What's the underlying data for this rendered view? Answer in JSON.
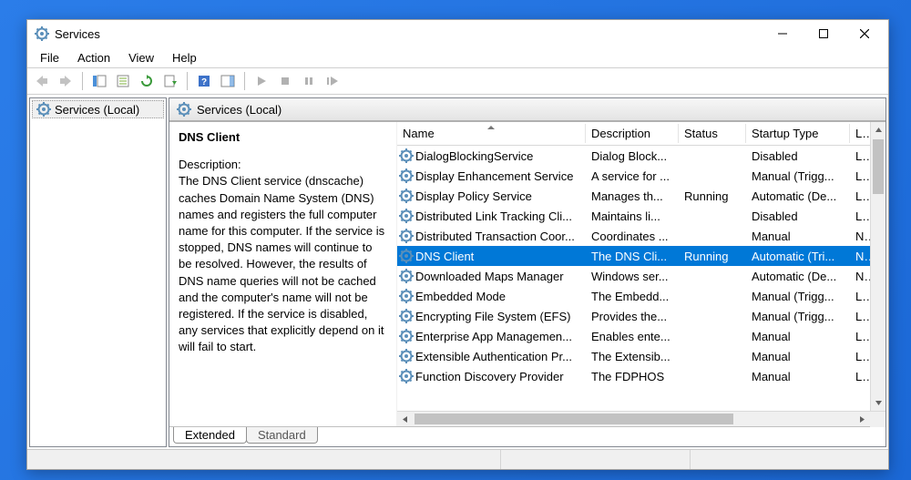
{
  "title": "Services",
  "menu": {
    "file": "File",
    "action": "Action",
    "view": "View",
    "help": "Help"
  },
  "tree": {
    "root": "Services (Local)"
  },
  "header": {
    "label": "Services (Local)"
  },
  "details": {
    "name": "DNS Client",
    "desc_label": "Description:",
    "desc_text": "The DNS Client service (dnscache) caches Domain Name System (DNS) names and registers the full computer name for this computer. If the service is stopped, DNS names will continue to be resolved. However, the results of DNS name queries will not be cached and the computer's name will not be registered. If the service is disabled, any services that explicitly depend on it will fail to start."
  },
  "columns": {
    "name": "Name",
    "desc": "Description",
    "status": "Status",
    "start": "Startup Type",
    "logon": "Log"
  },
  "rows": [
    {
      "name": "DialogBlockingService",
      "desc": "Dialog Block...",
      "status": "",
      "start": "Disabled",
      "logon": "Loc",
      "sel": false
    },
    {
      "name": "Display Enhancement Service",
      "desc": "A service for ...",
      "status": "",
      "start": "Manual (Trigg...",
      "logon": "Loc",
      "sel": false
    },
    {
      "name": "Display Policy Service",
      "desc": "Manages th...",
      "status": "Running",
      "start": "Automatic (De...",
      "logon": "Loc",
      "sel": false
    },
    {
      "name": "Distributed Link Tracking Cli...",
      "desc": "Maintains li...",
      "status": "",
      "start": "Disabled",
      "logon": "Loc",
      "sel": false
    },
    {
      "name": "Distributed Transaction Coor...",
      "desc": "Coordinates ...",
      "status": "",
      "start": "Manual",
      "logon": "Ne",
      "sel": false
    },
    {
      "name": "DNS Client",
      "desc": "The DNS Cli...",
      "status": "Running",
      "start": "Automatic (Tri...",
      "logon": "Ne",
      "sel": true
    },
    {
      "name": "Downloaded Maps Manager",
      "desc": "Windows ser...",
      "status": "",
      "start": "Automatic (De...",
      "logon": "Ne",
      "sel": false
    },
    {
      "name": "Embedded Mode",
      "desc": "The Embedd...",
      "status": "",
      "start": "Manual (Trigg...",
      "logon": "Loc",
      "sel": false
    },
    {
      "name": "Encrypting File System (EFS)",
      "desc": "Provides the...",
      "status": "",
      "start": "Manual (Trigg...",
      "logon": "Loc",
      "sel": false
    },
    {
      "name": "Enterprise App Managemen...",
      "desc": "Enables ente...",
      "status": "",
      "start": "Manual",
      "logon": "Loc",
      "sel": false
    },
    {
      "name": "Extensible Authentication Pr...",
      "desc": "The Extensib...",
      "status": "",
      "start": "Manual",
      "logon": "Loc",
      "sel": false
    },
    {
      "name": "Function Discovery Provider",
      "desc": "The FDPHOS",
      "status": "",
      "start": "Manual",
      "logon": "Loc",
      "sel": false
    }
  ],
  "tabs": {
    "extended": "Extended",
    "standard": "Standard"
  }
}
